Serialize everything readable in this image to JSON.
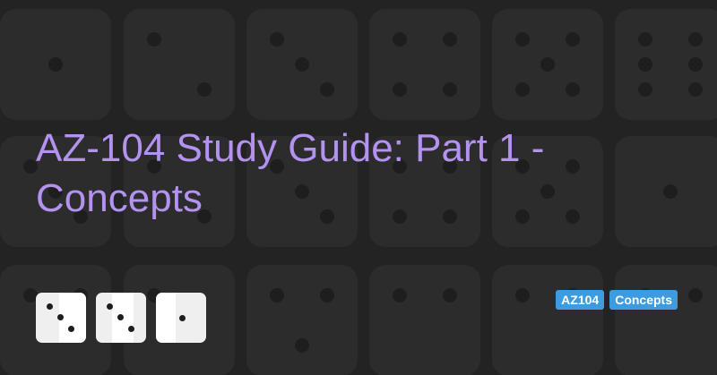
{
  "title": "AZ-104 Study Guide: Part 1 - Concepts",
  "tags": [
    "AZ104",
    "Concepts"
  ],
  "colors": {
    "background": "#232323",
    "title": "#b392f0",
    "tag": "#3d9be0",
    "die_face": "#efefef",
    "pip": "#1d1d1d"
  },
  "dice": [
    {
      "face": 3,
      "icon": "die-three-icon"
    },
    {
      "face": 3,
      "icon": "die-three-icon"
    },
    {
      "face": 1,
      "icon": "die-one-icon"
    }
  ]
}
